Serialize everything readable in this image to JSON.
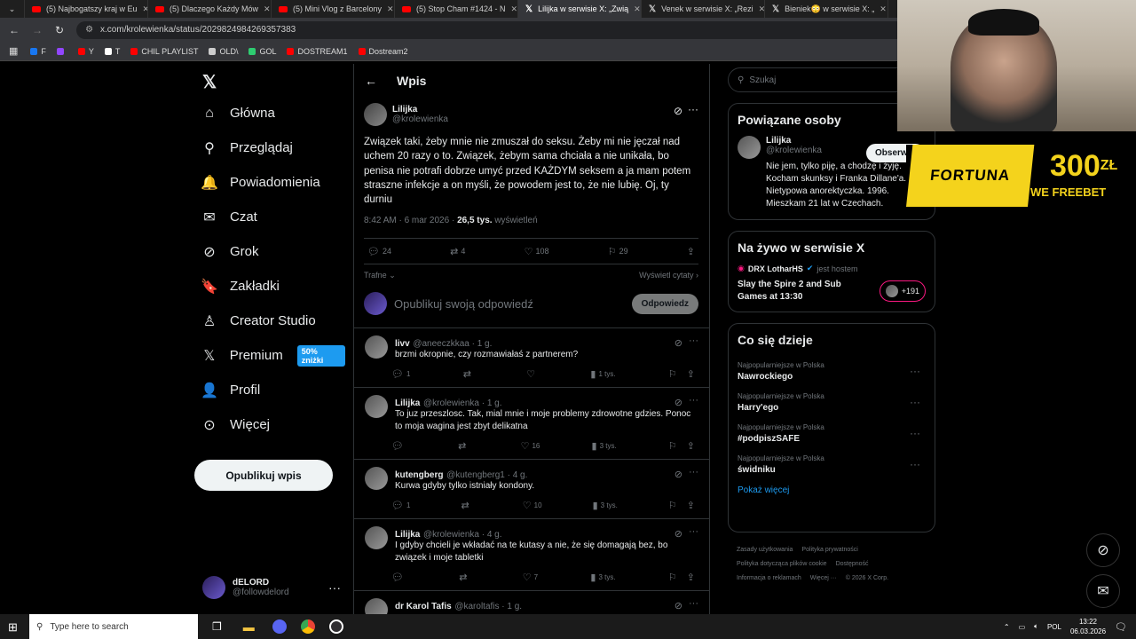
{
  "browser": {
    "tabs": [
      {
        "title": "(5) Najbogatszy kraj w Eu",
        "type": "youtube",
        "active": false
      },
      {
        "title": "(5) Dlaczego Każdy Mów",
        "type": "youtube",
        "active": false
      },
      {
        "title": "(5) Mini Vlog z Barcelony",
        "type": "youtube",
        "active": false
      },
      {
        "title": "(5) Stop Cham #1424 - N",
        "type": "youtube",
        "active": false
      },
      {
        "title": "Lilijka w serwisie X: „Zwią",
        "type": "x",
        "active": true
      },
      {
        "title": "Venek w serwisie X: „Rezi",
        "type": "x",
        "active": false
      },
      {
        "title": "Bieniek😳 w serwisie X: „",
        "type": "x",
        "active": false
      }
    ],
    "url": "x.com/krolewienka/status/2029824984269357383",
    "bookmarks": [
      {
        "label": "F",
        "color": "#1877f2"
      },
      {
        "label": "",
        "color": "#9146ff"
      },
      {
        "label": "Y",
        "color": "#ff0000"
      },
      {
        "label": "T",
        "color": "#ffffff"
      },
      {
        "label": "CHIL PLAYLIST",
        "color": "#ff0000"
      },
      {
        "label": "OLD\\",
        "color": "#cccccc"
      },
      {
        "label": "GOL",
        "color": "#2ecc71"
      },
      {
        "label": "DOSTREAM1",
        "color": "#ff0000"
      },
      {
        "label": "Dostream2",
        "color": "#ff0000"
      }
    ]
  },
  "nav": {
    "items": [
      {
        "label": "Główna",
        "icon": "home-icon",
        "glyph": "⌂"
      },
      {
        "label": "Przeglądaj",
        "icon": "search-icon",
        "glyph": "⚲"
      },
      {
        "label": "Powiadomienia",
        "icon": "bell-icon",
        "glyph": "🔔"
      },
      {
        "label": "Czat",
        "icon": "mail-icon",
        "glyph": "✉"
      },
      {
        "label": "Grok",
        "icon": "grok-icon",
        "glyph": "⊘"
      },
      {
        "label": "Zakładki",
        "icon": "bookmark-icon",
        "glyph": "🔖"
      },
      {
        "label": "Creator Studio",
        "icon": "creator-icon",
        "glyph": "♙"
      },
      {
        "label": "Premium",
        "icon": "x-premium-icon",
        "glyph": "𝕏"
      },
      {
        "label": "Profil",
        "icon": "profile-icon",
        "glyph": "👤"
      },
      {
        "label": "Więcej",
        "icon": "more-circle-icon",
        "glyph": "⊙"
      }
    ],
    "premium_badge": "50% zniżki",
    "post_button": "Opublikuj wpis",
    "account": {
      "name": "dELORD",
      "handle": "@followdelord"
    }
  },
  "post": {
    "header_title": "Wpis",
    "author_name": "Lilijka",
    "author_handle": "@krolewienka",
    "text": "Związek taki, żeby mnie nie zmuszał do seksu. Żeby mi nie jęczał nad uchem 20 razy o to. Związek, żebym sama chciała a nie unikała, bo penisa nie potrafi dobrze umyć przed KAŻDYM seksem a ja mam potem straszne infekcje a on myśli, że powodem jest to, że nie lubię. Oj, ty durniu",
    "time": "8:42 AM · 6 mar 2026 · ",
    "views": "26,5 tys.",
    "views_label": " wyświetleń",
    "replies": "24",
    "reposts": "4",
    "likes": "108",
    "bookmarks": "29",
    "sort_label": "Trafne",
    "quotes_label": "Wyświetl cytaty",
    "reply_placeholder": "Opublikuj swoją odpowiedź",
    "reply_button": "Odpowiedz"
  },
  "replies": [
    {
      "name": "livv",
      "handle": "@aneeczkkaa · 1 g.",
      "text": "brzmi okropnie, czy rozmawiałaś z partnerem?",
      "replies": "1",
      "reposts": "",
      "likes": "",
      "views": "1 tys."
    },
    {
      "name": "Lilijka",
      "handle": "@krolewienka · 1 g.",
      "text": "To juz przeszlosc. Tak, mial mnie i moje problemy zdrowotne gdzies. Ponoc to moja wagina jest zbyt delikatna",
      "replies": "",
      "reposts": "",
      "likes": "16",
      "views": "3 tys."
    },
    {
      "name": "kutengberg",
      "handle": "@kutengberg1 · 4 g.",
      "text": "Kurwa gdyby tylko istniały kondony.",
      "replies": "1",
      "reposts": "",
      "likes": "10",
      "views": "3 tys."
    },
    {
      "name": "Lilijka",
      "handle": "@krolewienka · 4 g.",
      "text": "I gdyby chcieli je wkładać na te kutasy a nie, że się domagają bez, bo związek i moje tabletki",
      "replies": "",
      "reposts": "",
      "likes": "7",
      "views": "3 tys."
    },
    {
      "name": "dr Karol Tafis",
      "handle": "@karoltafis · 1 g.",
      "text": "",
      "replies": "",
      "reposts": "",
      "likes": "",
      "views": ""
    }
  ],
  "right": {
    "search_placeholder": "Szukaj",
    "related_title": "Powiązane osoby",
    "related": {
      "name": "Lilijka",
      "handle": "@krolewienka",
      "follow": "Obserwuj",
      "bio": "Nie jem, tylko piję, a chodzę i żyję. Kocham skunksy i Franka Dillane'a. Nietypowa anorektyczka. 1996. Mieszkam 21 lat w Czechach."
    },
    "live_title": "Na żywo w serwisie X",
    "live": {
      "host": "DRX LotharHS",
      "host_suffix": "jest hostem",
      "title": "Slay the Spire 2 and Sub Games at 13:30",
      "count": "+191"
    },
    "trends_title": "Co się dzieje",
    "trends": [
      {
        "category": "Najpopularniejsze w Polska",
        "name": "Nawrockiego"
      },
      {
        "category": "Najpopularniejsze w Polska",
        "name": "Harry'ego"
      },
      {
        "category": "Najpopularniejsze w Polska",
        "name": "#podpiszSAFE"
      },
      {
        "category": "Najpopularniejsze w Polska",
        "name": "świdniku"
      }
    ],
    "show_more": "Pokaż więcej",
    "footer": [
      "Zasady użytkowania",
      "Polityka prywatności",
      "Polityka dotycząca plików cookie",
      "Dostępność",
      "Informacja o reklamach",
      "Więcej ···",
      "© 2026 X Corp."
    ]
  },
  "overlay": {
    "brand": "FORTUNA",
    "amount": "300",
    "currency": "ZŁ",
    "tagline": "WE FREEBET"
  },
  "taskbar": {
    "search_placeholder": "Type here to search",
    "lang": "POL",
    "time": "13:22",
    "date": "06.03.2026"
  }
}
